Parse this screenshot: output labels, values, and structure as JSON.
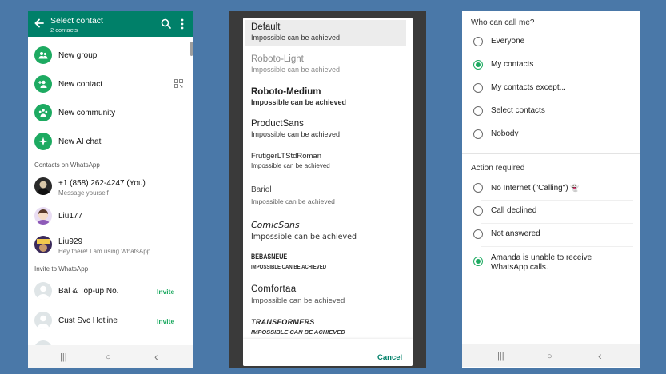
{
  "contacts_panel": {
    "title": "Select contact",
    "subtitle": "2 contacts",
    "actions": [
      {
        "label": "New group"
      },
      {
        "label": "New contact"
      },
      {
        "label": "New community"
      },
      {
        "label": "New AI chat"
      }
    ],
    "section_contacts": "Contacts on WhatsApp",
    "contacts": [
      {
        "name": "+1 (858) 262-4247 (You)",
        "status": "Message yourself"
      },
      {
        "name": "Liu177",
        "status": ""
      },
      {
        "name": "Liu929",
        "status": "Hey there! I am using WhatsApp."
      }
    ],
    "section_invite": "Invite to WhatsApp",
    "invites": [
      {
        "name": "Bal & Top-up No.",
        "action": "Invite"
      },
      {
        "name": "Cust Svc Hotline",
        "action": "Invite"
      }
    ],
    "nav": {
      "recent": "|||",
      "home": "○",
      "back": "‹"
    }
  },
  "font_panel": {
    "fonts": [
      {
        "name": "Default",
        "sample": "Impossible can be achieved"
      },
      {
        "name": "Roboto-Light",
        "sample": "Impossible can be achieved"
      },
      {
        "name": "Roboto-Medium",
        "sample": "Impossible can be achieved"
      },
      {
        "name": "ProductSans",
        "sample": "Impossible can be achieved"
      },
      {
        "name": "FrutigerLTStdRoman",
        "sample": "Impossible can be achieved"
      },
      {
        "name": "Bariol",
        "sample": "Impossible can be achieved"
      },
      {
        "name": "ComicSans",
        "sample": "Impossible can be achieved"
      },
      {
        "name": "BEBASNEUE",
        "sample": "IMPOSSIBLE CAN BE ACHIEVED"
      },
      {
        "name": "Comfortaa",
        "sample": "Impossible can be achieved"
      },
      {
        "name": "TRANSFORMERS",
        "sample": "IMPOSSIBLE CAN BE ACHIEVED"
      }
    ],
    "cancel_label": "Cancel"
  },
  "call_panel": {
    "header_who": "Who can call me?",
    "who_options": [
      {
        "label": "Everyone",
        "selected": false
      },
      {
        "label": "My contacts",
        "selected": true
      },
      {
        "label": "My contacts except...",
        "selected": false
      },
      {
        "label": "Select contacts",
        "selected": false
      },
      {
        "label": "Nobody",
        "selected": false
      }
    ],
    "header_action": "Action required",
    "action_options": [
      {
        "label": "No Internet (\"Calling\")",
        "selected": false
      },
      {
        "label": "Call declined",
        "selected": false
      },
      {
        "label": "Not answered",
        "selected": false
      },
      {
        "label": "Amanda is unable to receive",
        "label2": "WhatsApp calls.",
        "selected": true
      }
    ],
    "nav": {
      "recent": "|||",
      "home": "○",
      "back": "‹"
    }
  },
  "colors": {
    "brand": "#008069",
    "accent": "#1daa61",
    "background": "#4a78a8"
  }
}
